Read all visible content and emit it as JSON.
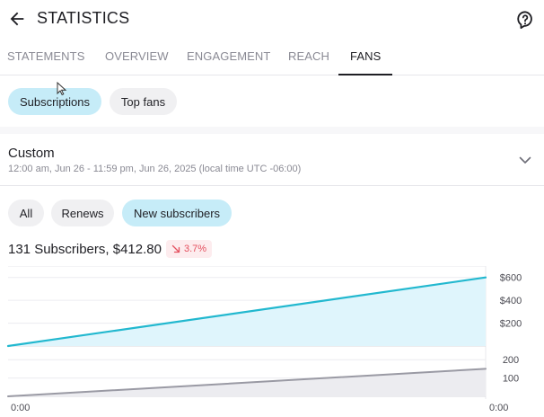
{
  "header": {
    "title": "STATISTICS",
    "back_icon": "arrow-left-icon",
    "help_icon": "help-bubble-icon"
  },
  "tabs": [
    {
      "label": "STATEMENTS",
      "active": false
    },
    {
      "label": "OVERVIEW",
      "active": false
    },
    {
      "label": "ENGAGEMENT",
      "active": false
    },
    {
      "label": "REACH",
      "active": false
    },
    {
      "label": "FANS",
      "active": true
    }
  ],
  "view_chips": [
    {
      "label": "Subscriptions",
      "selected": true
    },
    {
      "label": "Top fans",
      "selected": false
    }
  ],
  "date_range": {
    "label": "Custom",
    "detail": "12:00 am, Jun 26 - 11:59 pm, Jun 26, 2025 (local time UTC -06:00)",
    "chevron_icon": "chevron-down-icon"
  },
  "filter_chips": [
    {
      "label": "All",
      "selected": false
    },
    {
      "label": "Renews",
      "selected": false
    },
    {
      "label": "New subscribers",
      "selected": true
    }
  ],
  "summary": {
    "text": "131 Subscribers, $412.80",
    "trend_icon": "arrow-down-right-icon",
    "trend": "3.7%",
    "trend_color": "#e4505f"
  },
  "colors": {
    "accent": "#c6ecf8",
    "earnings_line": "#22b8cf",
    "subscribers_line": "#9a9aa4"
  },
  "chart_data": [
    {
      "type": "area",
      "series": [
        {
          "values": [
            0,
            600
          ]
        }
      ],
      "x": [
        "0:00",
        "0:00"
      ],
      "ylim": [
        0,
        700
      ],
      "yticks": [
        "$600",
        "$400",
        "$200"
      ],
      "ytick_values": [
        600,
        400,
        200
      ],
      "grid": true
    },
    {
      "type": "area",
      "series": [
        {
          "values": [
            0,
            150
          ]
        }
      ],
      "x": [
        "0:00",
        "0:00"
      ],
      "ylim": [
        0,
        250
      ],
      "yticks": [
        "200",
        "100"
      ],
      "ytick_values": [
        200,
        100
      ],
      "xtick_labels": [
        "0:00",
        "0:00"
      ],
      "grid": true
    }
  ]
}
